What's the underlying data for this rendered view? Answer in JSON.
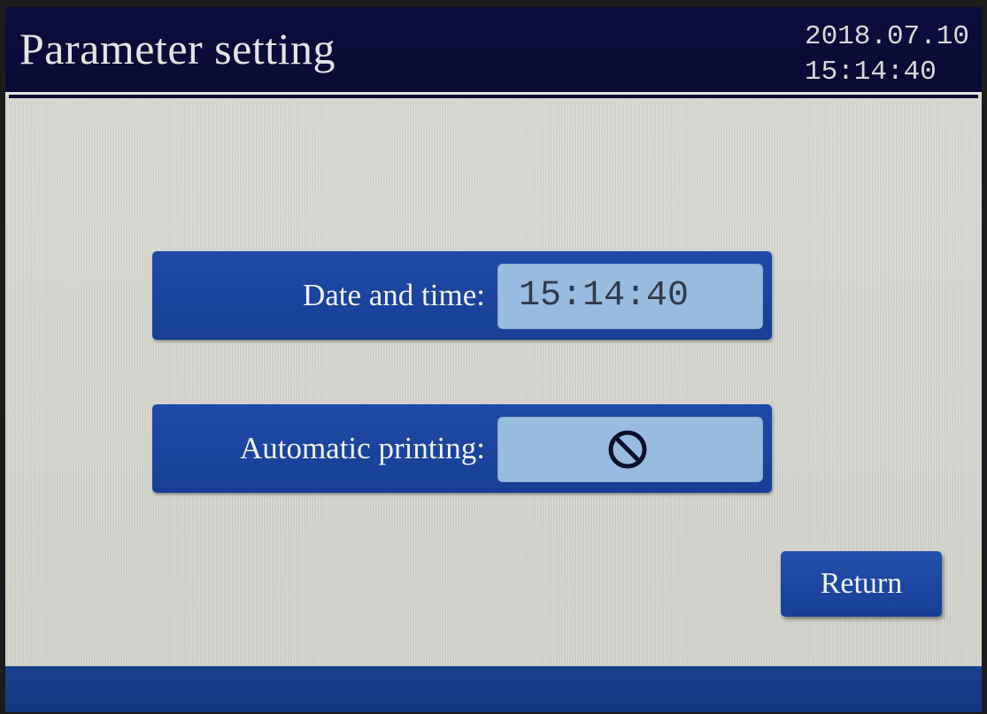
{
  "header": {
    "title": "Parameter setting",
    "date": "2018.07.10",
    "time": "15:14:40"
  },
  "fields": {
    "date_time": {
      "label": "Date and time:",
      "value": "15:14:40"
    },
    "automatic_printing": {
      "label": "Automatic printing:",
      "state_icon": "prohibited-icon"
    }
  },
  "buttons": {
    "return_label": "Return"
  },
  "colors": {
    "header_bg": "#0b0c3e",
    "panel_blue": "#1e4aa6",
    "value_box": "#98bce0",
    "screen_bg": "#d8d8d2",
    "footer_bg": "#1a3f8f"
  }
}
